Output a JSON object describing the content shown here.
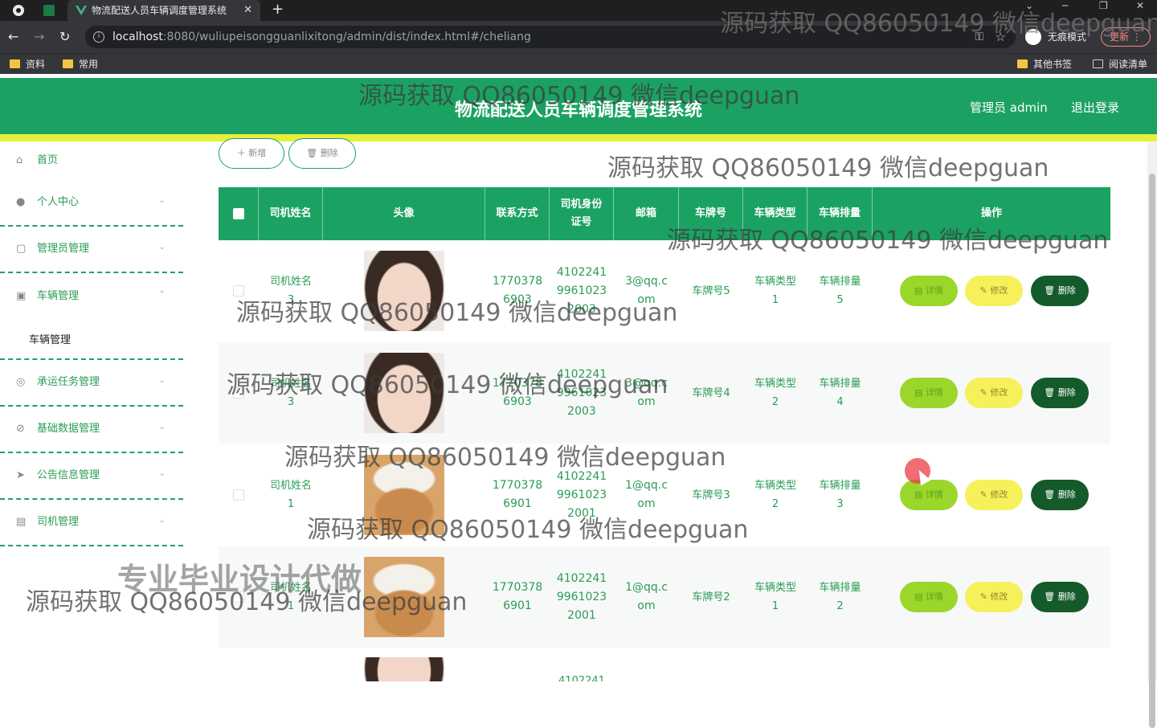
{
  "browser": {
    "tab_title": "物流配送人员车辆调度管理系统",
    "url_host": "localhost",
    "url_path": ":8080/wuliupeisongguanlixitong/admin/dist/index.html#/cheliang",
    "incognito_label": "无痕模式",
    "update_label": "更新",
    "bookmarks": [
      "资料",
      "常用"
    ],
    "bookmarks_right": [
      "其他书签",
      "阅读清单"
    ]
  },
  "header": {
    "title": "物流配送人员车辆调度管理系统",
    "admin_label": "管理员 admin",
    "logout_label": "退出登录"
  },
  "sidebar": {
    "items": [
      {
        "label": "首页",
        "icon": "home-icon"
      },
      {
        "label": "个人中心",
        "icon": "user-icon"
      },
      {
        "label": "管理员管理",
        "icon": "admin-icon"
      },
      {
        "label": "车辆管理",
        "icon": "vehicle-icon"
      },
      {
        "label": "承运任务管理",
        "icon": "task-icon"
      },
      {
        "label": "基础数据管理",
        "icon": "data-icon"
      },
      {
        "label": "公告信息管理",
        "icon": "notice-icon"
      },
      {
        "label": "司机管理",
        "icon": "driver-icon"
      }
    ],
    "sub_item": "车辆管理"
  },
  "toolbar": {
    "add_label": "＋ 新增",
    "delete_label": "🗑 删除"
  },
  "table": {
    "headers": [
      "司机姓名",
      "头像",
      "联系方式",
      "司机身份\n证号",
      "邮箱",
      "车牌号",
      "车辆类型",
      "车辆排量",
      "操作"
    ],
    "rows": [
      {
        "name": "司机姓名\n3",
        "phone": "1770378\n6903",
        "idcard": "4102241\n9961023\n2003",
        "email": "3@qq.c\nom",
        "plate": "车牌号5",
        "type": "车辆类型\n1",
        "displacement": "车辆排量\n5",
        "avatar": "woman"
      },
      {
        "name": "司机姓名\n3",
        "phone": "1770378\n6903",
        "idcard": "4102241\n9961023\n2003",
        "email": "3@qq.c\nom",
        "plate": "车牌号4",
        "type": "车辆类型\n2",
        "displacement": "车辆排量\n4",
        "avatar": "woman"
      },
      {
        "name": "司机姓名\n1",
        "phone": "1770378\n6901",
        "idcard": "4102241\n9961023\n2001",
        "email": "1@qq.c\nom",
        "plate": "车牌号3",
        "type": "车辆类型\n2",
        "displacement": "车辆排量\n3",
        "avatar": "cat"
      },
      {
        "name": "司机姓名\n1",
        "phone": "1770378\n6901",
        "idcard": "4102241\n9961023\n2001",
        "email": "1@qq.c\nom",
        "plate": "车牌号2",
        "type": "车辆类型\n1",
        "displacement": "车辆排量\n2",
        "avatar": "cat"
      }
    ],
    "partial_row_idcard": "4102241",
    "actions": {
      "detail": "▤ 详情",
      "edit": "✎ 修改",
      "delete": "🗑 删除"
    }
  },
  "watermarks": {
    "text": "源码获取 QQ86050149 微信deepguan",
    "big": "专业毕业设计代做"
  },
  "colors": {
    "primary": "#1ba262",
    "accent_yellow": "#e8ef3a",
    "detail": "#9bd62b",
    "edit": "#f6f05a",
    "delete": "#145a2a"
  }
}
